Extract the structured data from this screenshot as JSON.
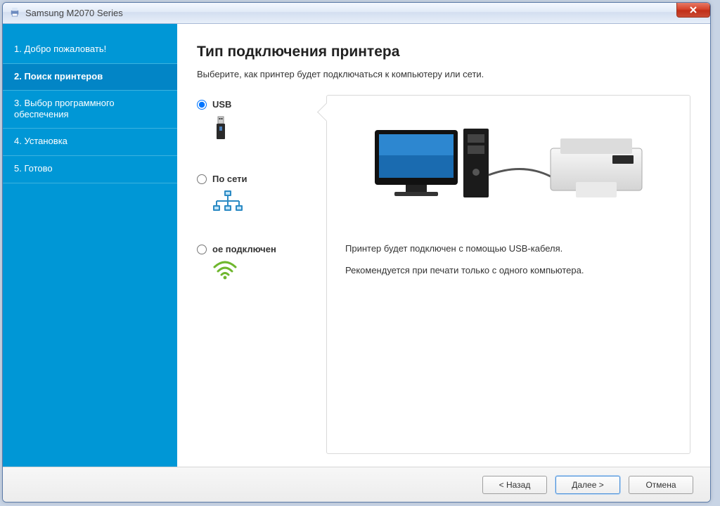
{
  "window": {
    "title": "Samsung M2070 Series"
  },
  "sidebar": {
    "steps": [
      {
        "label": "1. Добро пожаловать!"
      },
      {
        "label": "2. Поиск принтеров"
      },
      {
        "label": "3. Выбор программного обеспечения"
      },
      {
        "label": "4. Установка"
      },
      {
        "label": "5. Готово"
      }
    ]
  },
  "main": {
    "heading": "Тип подключения принтера",
    "subtitle": "Выберите, как принтер будет подключаться к компьютеру или сети."
  },
  "options": {
    "usb": {
      "label": "USB"
    },
    "network": {
      "label": "По сети"
    },
    "wireless": {
      "label": "ое подключен"
    }
  },
  "detail": {
    "line1": "Принтер будет подключен с помощью USB-кабеля.",
    "line2": "Рекомендуется при печати только с одного компьютера."
  },
  "footer": {
    "back": "< Назад",
    "next": "Далее >",
    "cancel": "Отмена"
  }
}
